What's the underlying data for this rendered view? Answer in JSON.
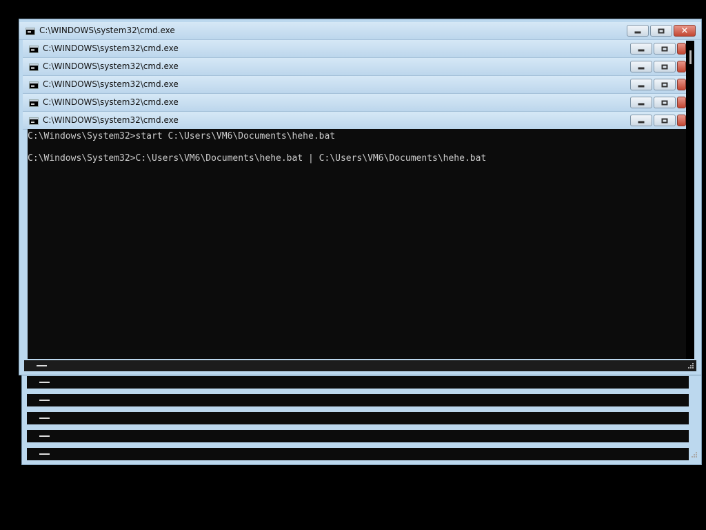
{
  "windows": [
    {
      "title": "C:\\WINDOWS\\system32\\cmd.exe"
    },
    {
      "title": "C:\\WINDOWS\\system32\\cmd.exe"
    },
    {
      "title": "C:\\WINDOWS\\system32\\cmd.exe"
    },
    {
      "title": "C:\\WINDOWS\\system32\\cmd.exe"
    },
    {
      "title": "C:\\WINDOWS\\system32\\cmd.exe"
    },
    {
      "title": "C:\\WINDOWS\\system32\\cmd.exe"
    }
  ],
  "console": {
    "lines": [
      "C:\\Windows\\System32>start C:\\Users\\VM6\\Documents\\hehe.bat",
      "C:\\Windows\\System32>C:\\Users\\VM6\\Documents\\hehe.bat | C:\\Users\\VM6\\Documents\\hehe.bat"
    ]
  },
  "icons": {
    "window": "cmd-icon",
    "minimize": "minimize-icon",
    "maximize": "maximize-icon",
    "close": "close-icon"
  },
  "colors": {
    "frame": "#bcd8ee",
    "console_bg": "#0c0c0c",
    "console_text": "#cccccc",
    "close_button": "#c24632"
  }
}
